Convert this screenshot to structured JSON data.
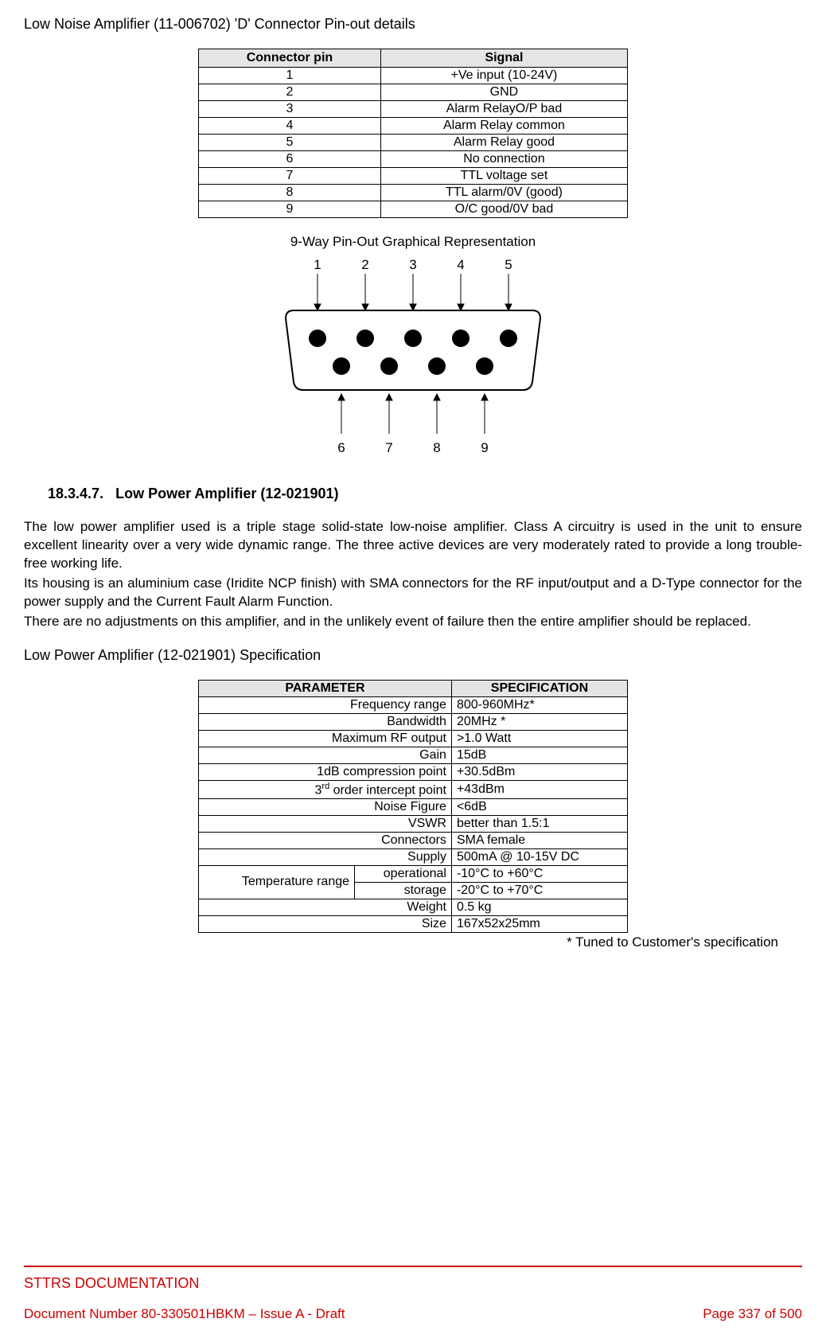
{
  "title": "Low Noise Amplifier (11-006702) 'D' Connector Pin-out details",
  "pinTable": {
    "headers": {
      "col1": "Connector pin",
      "col2": "Signal"
    },
    "rows": [
      {
        "pin": "1",
        "signal": "+Ve input (10-24V)"
      },
      {
        "pin": "2",
        "signal": "GND"
      },
      {
        "pin": "3",
        "signal": "Alarm RelayO/P bad"
      },
      {
        "pin": "4",
        "signal": "Alarm Relay common"
      },
      {
        "pin": "5",
        "signal": "Alarm Relay good"
      },
      {
        "pin": "6",
        "signal": "No connection"
      },
      {
        "pin": "7",
        "signal": "TTL voltage set"
      },
      {
        "pin": "8",
        "signal": "TTL alarm/0V (good)"
      },
      {
        "pin": "9",
        "signal": "O/C good/0V bad"
      }
    ]
  },
  "diagram": {
    "title": "9-Way Pin-Out Graphical Representation",
    "top": [
      "1",
      "2",
      "3",
      "4",
      "5"
    ],
    "bottom": [
      "6",
      "7",
      "8",
      "9"
    ]
  },
  "sectionNumber": "18.3.4.7.",
  "sectionTitle": "Low Power Amplifier (12-021901)",
  "para1": "The low power amplifier used is a triple stage solid-state low-noise amplifier. Class A circuitry is used in the unit to ensure excellent linearity over a very wide dynamic range. The three active devices are very moderately rated to provide a long trouble-free working life.",
  "para2": "Its housing is an aluminium case (Iridite NCP finish) with SMA connectors for the RF input/output and a D-Type connector for the power supply and the Current Fault Alarm Function.",
  "para3": "There are no adjustments on this amplifier, and in the unlikely event of failure then the entire amplifier should be replaced.",
  "specSubtitle": "Low Power Amplifier (12-021901) Specification",
  "specTable": {
    "headers": {
      "col1": "PARAMETER",
      "col2": "SPECIFICATION"
    },
    "rows": [
      {
        "param": "Frequency range",
        "value": "800-960MHz*"
      },
      {
        "param": "Bandwidth",
        "value": "20MHz *"
      },
      {
        "param": "Maximum RF output",
        "value": ">1.0 Watt"
      },
      {
        "param": "Gain",
        "value": "15dB"
      },
      {
        "param": "1dB compression point",
        "value": "+30.5dBm"
      },
      {
        "param_html": "3<sup>rd</sup> order intercept point",
        "value": "+43dBm"
      },
      {
        "param": "Noise Figure",
        "value": "<6dB"
      },
      {
        "param": "VSWR",
        "value": "better than 1.5:1"
      },
      {
        "param": "Connectors",
        "value": "SMA female"
      },
      {
        "param": "Supply",
        "value": "500mA @ 10-15V DC"
      }
    ],
    "tempGroup": {
      "label": "Temperature range",
      "rows": [
        {
          "sub": "operational",
          "value": "-10°C to +60°C"
        },
        {
          "sub": "storage",
          "value": "-20°C to +70°C"
        }
      ]
    },
    "tail": [
      {
        "param": "Weight",
        "value": "0.5 kg"
      },
      {
        "param": "Size",
        "value": "167x52x25mm"
      }
    ]
  },
  "footnote": "* Tuned to Customer's specification",
  "footer": {
    "title": "STTRS DOCUMENTATION",
    "left": "Document Number 80-330501HBKM – Issue A - Draft",
    "right": "Page 337 of 500"
  }
}
